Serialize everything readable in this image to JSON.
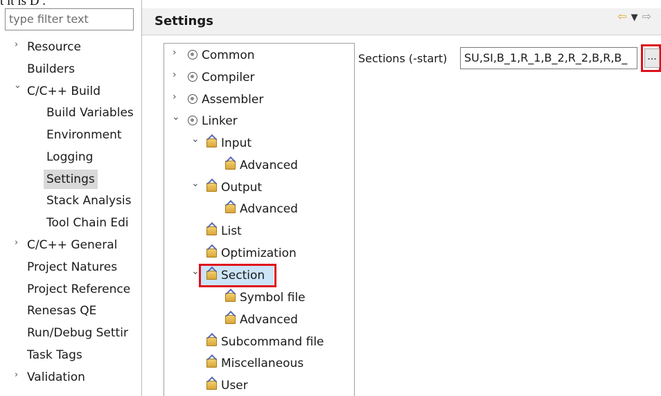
{
  "caption": "t it is D .",
  "filter": {
    "placeholder": "type filter text"
  },
  "nav": {
    "items": [
      {
        "label": "Resource",
        "twisty": "›"
      },
      {
        "label": "Builders"
      },
      {
        "label": "C/C++ Build",
        "twisty": "⌄"
      },
      {
        "label": "Build Variables"
      },
      {
        "label": "Environment"
      },
      {
        "label": "Logging"
      },
      {
        "label": "Settings"
      },
      {
        "label": "Stack Analysis"
      },
      {
        "label": "Tool Chain Edi"
      },
      {
        "label": "C/C++ General",
        "twisty": "›"
      },
      {
        "label": "Project Natures"
      },
      {
        "label": "Project Reference"
      },
      {
        "label": "Renesas QE"
      },
      {
        "label": "Run/Debug Settir"
      },
      {
        "label": "Task Tags"
      },
      {
        "label": "Validation",
        "twisty": "›"
      }
    ]
  },
  "header": {
    "title": "Settings",
    "back_icon": "⇦",
    "menu_icon": "▼",
    "forward_icon": "⇨"
  },
  "tree": {
    "items": [
      {
        "label": "Common",
        "twisty": "›"
      },
      {
        "label": "Compiler",
        "twisty": "›"
      },
      {
        "label": "Assembler",
        "twisty": "›"
      },
      {
        "label": "Linker",
        "twisty": "⌄"
      },
      {
        "label": "Input",
        "twisty": "⌄"
      },
      {
        "label": "Advanced"
      },
      {
        "label": "Output",
        "twisty": "⌄"
      },
      {
        "label": "Advanced"
      },
      {
        "label": "List"
      },
      {
        "label": "Optimization"
      },
      {
        "label": "Section",
        "twisty": "⌄"
      },
      {
        "label": "Symbol file"
      },
      {
        "label": "Advanced"
      },
      {
        "label": "Subcommand file"
      },
      {
        "label": "Miscellaneous"
      },
      {
        "label": "User"
      }
    ]
  },
  "property": {
    "label": "Sections (-start)",
    "value": "SU,SI,B_1,R_1,B_2,R_2,B,R,B_",
    "browse_label": "..."
  },
  "colors": {
    "highlight": "#e0101b",
    "selection": "#cce4f7"
  }
}
